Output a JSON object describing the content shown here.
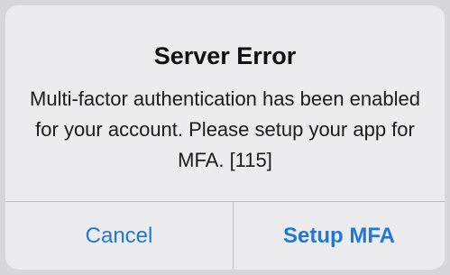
{
  "alert": {
    "title": "Server Error",
    "message": "Multi-factor authentication has been enabled for your account. Please setup your app for MFA. [115]",
    "buttons": {
      "cancel_label": "Cancel",
      "setup_label": "Setup MFA"
    }
  },
  "colors": {
    "accent": "#1f77d6",
    "alert_background": "#ececee",
    "divider": "#bdbdc2"
  }
}
